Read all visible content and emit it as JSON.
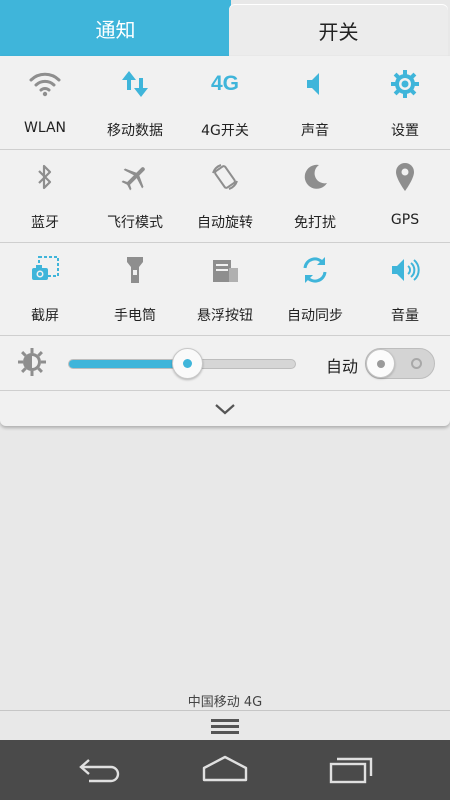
{
  "tabs": {
    "notify": "通知",
    "switches": "开关"
  },
  "colors": {
    "accent": "#3fb5da",
    "icon_gray": "#8e8e8e",
    "navbar": "#4a4a4a"
  },
  "toggles": {
    "row1": [
      {
        "label": "WLAN",
        "icon": "wifi-icon",
        "active": false
      },
      {
        "label": "移动数据",
        "icon": "mobile-data-icon",
        "active": true
      },
      {
        "label": "4G开关",
        "icon": "4g-icon",
        "icon_text": "4G",
        "active": true
      },
      {
        "label": "声音",
        "icon": "sound-icon",
        "active": true
      },
      {
        "label": "设置",
        "icon": "settings-gear-icon",
        "active": true
      }
    ],
    "row2": [
      {
        "label": "蓝牙",
        "icon": "bluetooth-icon",
        "active": false
      },
      {
        "label": "飞行模式",
        "icon": "airplane-icon",
        "active": false
      },
      {
        "label": "自动旋转",
        "icon": "auto-rotate-icon",
        "active": false
      },
      {
        "label": "免打扰",
        "icon": "moon-icon",
        "active": false
      },
      {
        "label": "GPS",
        "icon": "location-pin-icon",
        "active": false
      }
    ],
    "row3": [
      {
        "label": "截屏",
        "icon": "screenshot-icon",
        "active": true
      },
      {
        "label": "手电筒",
        "icon": "flashlight-icon",
        "active": false
      },
      {
        "label": "悬浮按钮",
        "icon": "floating-button-icon",
        "active": false
      },
      {
        "label": "自动同步",
        "icon": "sync-icon",
        "active": true
      },
      {
        "label": "音量",
        "icon": "volume-icon",
        "active": true
      }
    ]
  },
  "brightness": {
    "level_fraction": 0.52,
    "auto_label": "自动",
    "auto_enabled": false
  },
  "status": {
    "carrier": "中国移动 4G"
  }
}
